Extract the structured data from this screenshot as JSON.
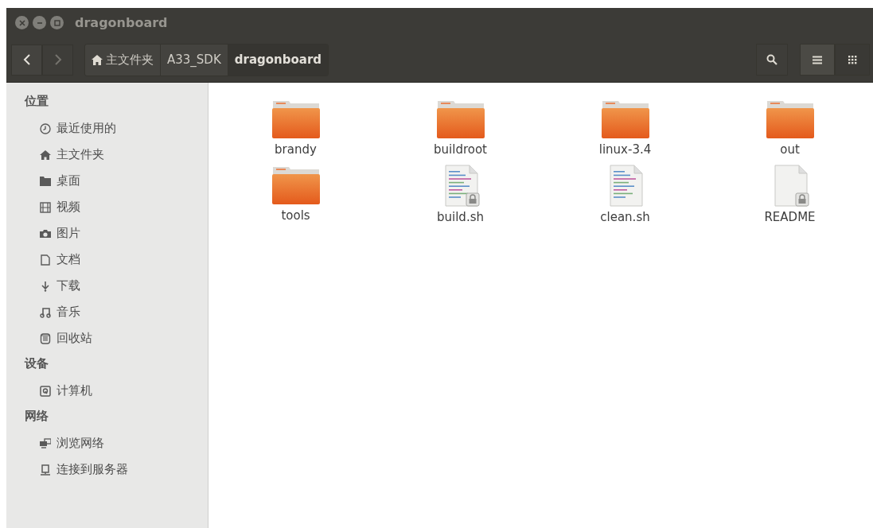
{
  "window": {
    "title": "dragonboard"
  },
  "toolbar": {
    "nav": [
      {
        "kind": "back",
        "disabled": false
      },
      {
        "kind": "forward",
        "disabled": true
      }
    ],
    "breadcrumbs": [
      {
        "label": "主文件夹",
        "kind": "home",
        "selected": false
      },
      {
        "label": "A33_SDK",
        "kind": "folder",
        "selected": false
      },
      {
        "label": "dragonboard",
        "kind": "folder",
        "selected": true
      }
    ],
    "views": [
      {
        "kind": "list",
        "selected": true
      },
      {
        "kind": "grid",
        "selected": false
      }
    ]
  },
  "sidebar": {
    "sections": [
      {
        "title": "位置",
        "items": [
          {
            "label": "最近使用的"
          },
          {
            "label": "主文件夹"
          },
          {
            "label": "桌面"
          },
          {
            "label": "视频"
          },
          {
            "label": "图片"
          },
          {
            "label": "文档"
          },
          {
            "label": "下载"
          },
          {
            "label": "音乐"
          },
          {
            "label": "回收站"
          }
        ]
      },
      {
        "title": "设备",
        "items": [
          {
            "label": "计算机"
          }
        ]
      },
      {
        "title": "网络",
        "items": [
          {
            "label": "浏览网络"
          },
          {
            "label": "连接到服务器"
          }
        ]
      }
    ]
  },
  "files": [
    {
      "name": "brandy",
      "kind": "folder"
    },
    {
      "name": "buildroot",
      "kind": "folder"
    },
    {
      "name": "linux-3.4",
      "kind": "folder"
    },
    {
      "name": "out",
      "kind": "folder"
    },
    {
      "name": "tools",
      "kind": "folder"
    },
    {
      "name": "build.sh",
      "kind": "script",
      "locked": true
    },
    {
      "name": "clean.sh",
      "kind": "script",
      "locked": false
    },
    {
      "name": "README",
      "kind": "text",
      "locked": true
    }
  ]
}
